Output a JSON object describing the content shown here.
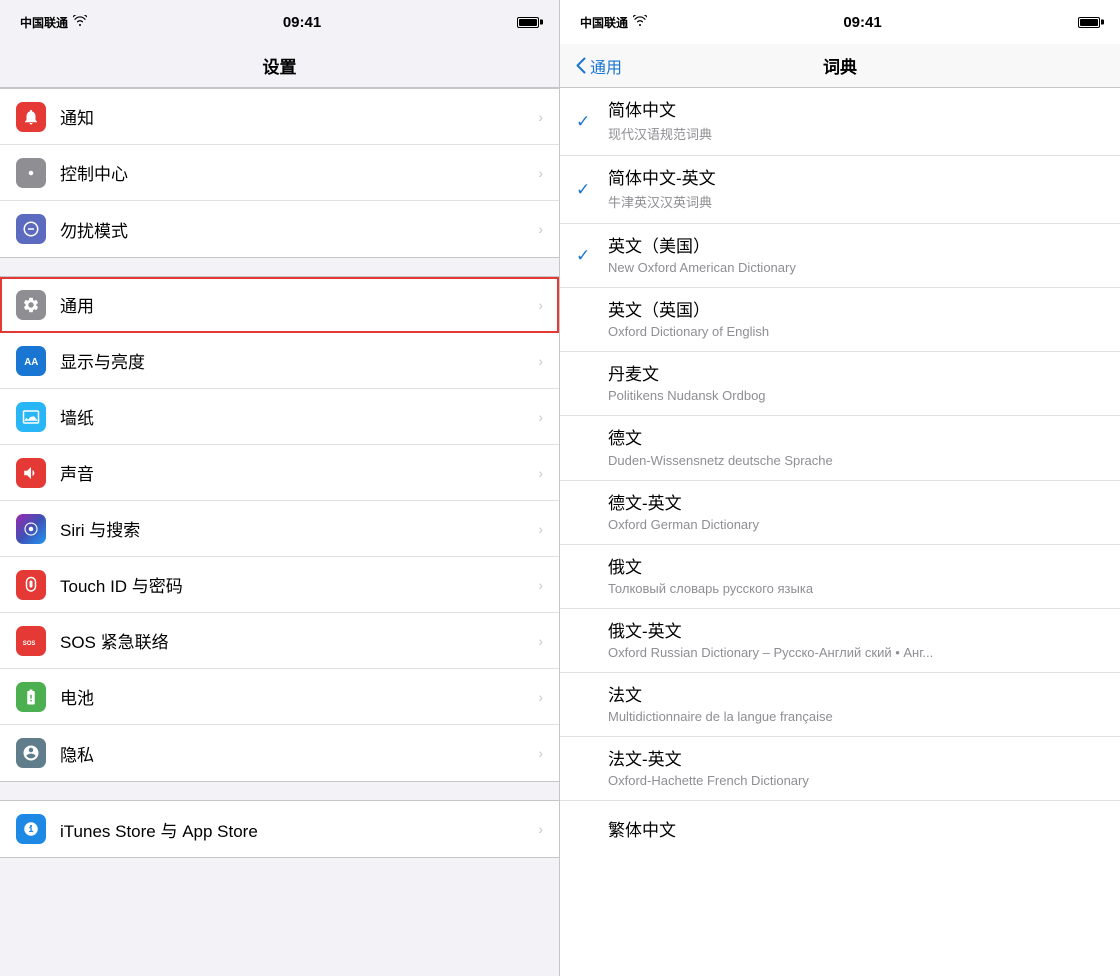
{
  "left": {
    "statusBar": {
      "carrier": "中国联通",
      "wifi": "WiFi",
      "time": "09:41",
      "battery": "100"
    },
    "pageTitle": "设置",
    "groups": [
      {
        "items": [
          {
            "id": "notifications",
            "icon": "red",
            "iconSymbol": "🔔",
            "label": "通知",
            "highlighted": false
          },
          {
            "id": "control-center",
            "icon": "gray",
            "iconSymbol": "⚙",
            "label": "控制中心",
            "highlighted": false
          },
          {
            "id": "dnd",
            "icon": "purple",
            "iconSymbol": "🌙",
            "label": "勿扰模式",
            "highlighted": false
          }
        ]
      },
      {
        "items": [
          {
            "id": "general",
            "icon": "gear",
            "iconSymbol": "⚙",
            "label": "通用",
            "highlighted": true
          },
          {
            "id": "display",
            "icon": "blue-aa",
            "iconSymbol": "AA",
            "label": "显示与亮度",
            "highlighted": false
          },
          {
            "id": "wallpaper",
            "icon": "blue-wallpaper",
            "iconSymbol": "🖼",
            "label": "墙纸",
            "highlighted": false
          },
          {
            "id": "sounds",
            "icon": "orange-sound",
            "iconSymbol": "🔊",
            "label": "声音",
            "highlighted": false
          },
          {
            "id": "siri",
            "icon": "siri",
            "iconSymbol": "◉",
            "label": "Siri 与搜索",
            "highlighted": false
          },
          {
            "id": "touchid",
            "icon": "touch-red",
            "iconSymbol": "◎",
            "label": "Touch ID 与密码",
            "highlighted": false
          },
          {
            "id": "sos",
            "icon": "sos",
            "iconSymbol": "SOS",
            "label": "SOS 紧急联络",
            "highlighted": false
          },
          {
            "id": "battery",
            "icon": "green-battery",
            "iconSymbol": "🔋",
            "label": "电池",
            "highlighted": false
          },
          {
            "id": "privacy",
            "icon": "privacy",
            "iconSymbol": "✋",
            "label": "隐私",
            "highlighted": false
          }
        ]
      },
      {
        "items": [
          {
            "id": "itunes",
            "icon": "itunes-blue",
            "iconSymbol": "🅐",
            "label": "iTunes Store 与 App Store",
            "highlighted": false
          }
        ]
      }
    ]
  },
  "right": {
    "statusBar": {
      "carrier": "中国联通",
      "wifi": "WiFi",
      "time": "09:41"
    },
    "backLabel": "通用",
    "pageTitle": "词典",
    "dictionaries": [
      {
        "id": "simplified-zh",
        "checked": true,
        "name": "简体中文",
        "sub": "现代汉语规范词典"
      },
      {
        "id": "simplified-zh-en",
        "checked": true,
        "name": "简体中文-英文",
        "sub": "牛津英汉汉英词典"
      },
      {
        "id": "en-us",
        "checked": true,
        "name": "英文（美国）",
        "sub": "New Oxford American Dictionary"
      },
      {
        "id": "en-uk",
        "checked": false,
        "name": "英文（英国）",
        "sub": "Oxford Dictionary of English"
      },
      {
        "id": "danish",
        "checked": false,
        "name": "丹麦文",
        "sub": "Politikens Nudansk Ordbog"
      },
      {
        "id": "german",
        "checked": false,
        "name": "德文",
        "sub": "Duden-Wissensnetz deutsche Sprache"
      },
      {
        "id": "german-en",
        "checked": false,
        "name": "德文-英文",
        "sub": "Oxford German Dictionary"
      },
      {
        "id": "russian",
        "checked": false,
        "name": "俄文",
        "sub": "Толковый словарь русского языка"
      },
      {
        "id": "russian-en",
        "checked": false,
        "name": "俄文-英文",
        "sub": "Oxford Russian Dictionary – Русско-Англий ский • Анг..."
      },
      {
        "id": "french",
        "checked": false,
        "name": "法文",
        "sub": "Multidictionnaire de la langue française"
      },
      {
        "id": "french-en",
        "checked": false,
        "name": "法文-英文",
        "sub": "Oxford-Hachette French Dictionary"
      },
      {
        "id": "traditional-zh",
        "checked": false,
        "name": "繁体中文",
        "sub": ""
      }
    ]
  }
}
